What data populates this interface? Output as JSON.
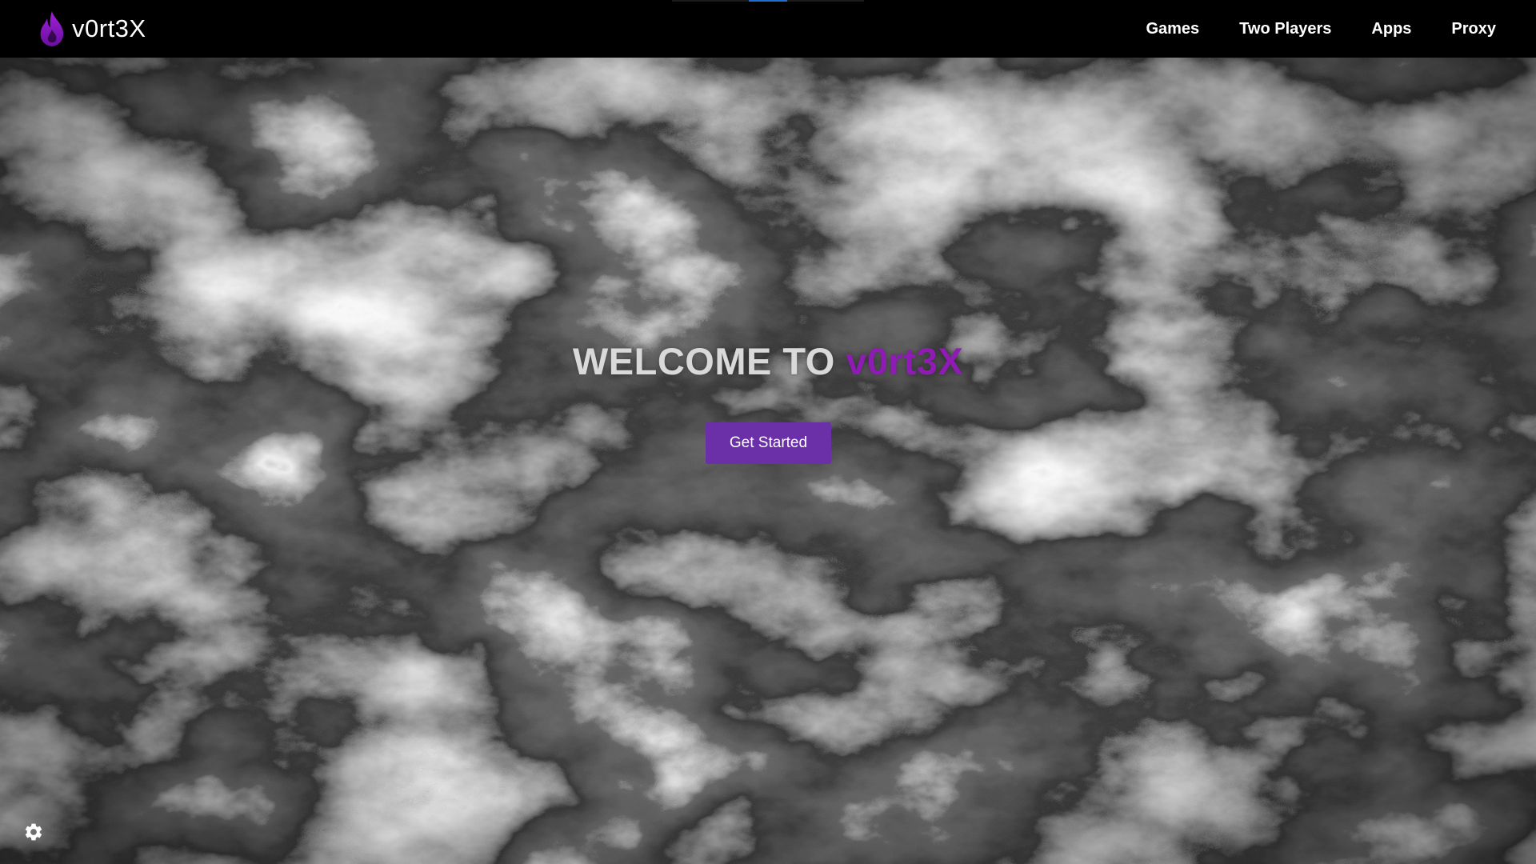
{
  "brand": {
    "name": "v0rt3X",
    "logo_icon": "flame-icon",
    "accent_color": "#8e1bb3"
  },
  "nav": {
    "items": [
      {
        "label": "Games"
      },
      {
        "label": "Two Players"
      },
      {
        "label": "Apps"
      },
      {
        "label": "Proxy"
      }
    ]
  },
  "hero": {
    "title_prefix": "WELCOME TO ",
    "title_brand": "v0rt3X",
    "cta_label": "Get Started",
    "cta_color": "#6b2fa8",
    "background": "black-and-white marble texture"
  },
  "settings": {
    "icon": "gear-icon"
  }
}
